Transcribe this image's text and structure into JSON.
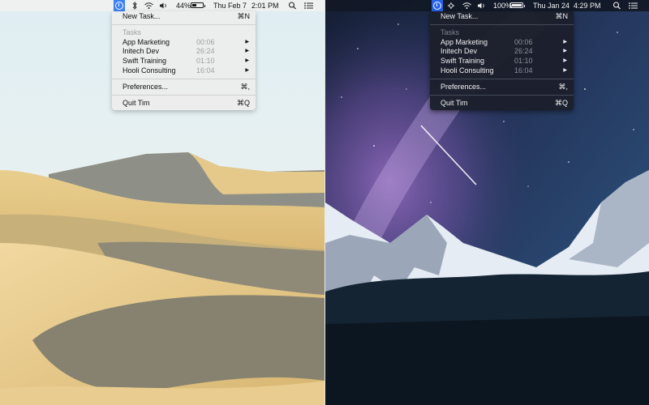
{
  "screens": [
    {
      "id": "light",
      "menubar": {
        "battery_percent": "44%",
        "battery_level": 0.44,
        "date": "Thu Feb 7",
        "time": "2:01 PM",
        "icons": [
          "timer-app-icon",
          "bluetooth-icon",
          "wifi-icon",
          "volume-icon",
          "battery-icon",
          "spotlight-icon",
          "notification-center-icon"
        ]
      },
      "menu": {
        "new_task": {
          "label": "New Task...",
          "shortcut": "⌘N"
        },
        "tasks_header": "Tasks",
        "tasks": [
          {
            "name": "App Marketing",
            "duration": "00:06"
          },
          {
            "name": "Initech Dev",
            "duration": "26:24"
          },
          {
            "name": "Swift Training",
            "duration": "01:10"
          },
          {
            "name": "Hooli Consulting",
            "duration": "16:04"
          }
        ],
        "preferences": {
          "label": "Preferences...",
          "shortcut": "⌘,"
        },
        "quit": {
          "label": "Quit Tim",
          "shortcut": "⌘Q"
        }
      }
    },
    {
      "id": "dark",
      "menubar": {
        "battery_percent": "100%",
        "battery_level": 1.0,
        "date": "Thu Jan 24",
        "time": "4:29 PM",
        "icons": [
          "timer-app-icon",
          "airplay-icon",
          "wifi-icon",
          "volume-icon",
          "battery-charging-icon",
          "spotlight-icon",
          "notification-center-icon"
        ]
      },
      "menu": {
        "new_task": {
          "label": "New Task...",
          "shortcut": "⌘N"
        },
        "tasks_header": "Tasks",
        "tasks": [
          {
            "name": "App Marketing",
            "duration": "00:06"
          },
          {
            "name": "Initech Dev",
            "duration": "26:24"
          },
          {
            "name": "Swift Training",
            "duration": "01:10"
          },
          {
            "name": "Hooli Consulting",
            "duration": "16:04"
          }
        ],
        "preferences": {
          "label": "Preferences...",
          "shortcut": "⌘,"
        },
        "quit": {
          "label": "Quit Tim",
          "shortcut": "⌘Q"
        }
      }
    }
  ],
  "colors": {
    "accent": "#3b82f6",
    "light_menu": "#ececec",
    "dark_menu": "#1c202c"
  }
}
